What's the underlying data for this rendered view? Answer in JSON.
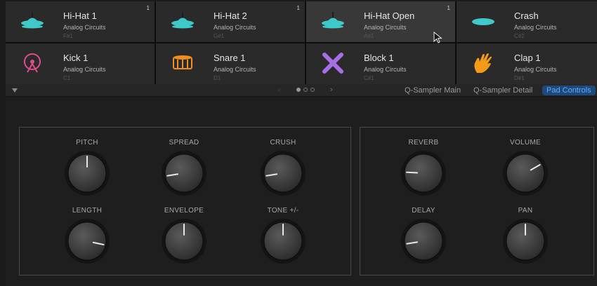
{
  "pads": [
    {
      "name": "Hi-Hat 1",
      "kit": "Analog Circuits",
      "note": "F#1",
      "badge": "1",
      "icon": "hihat-icon",
      "color": "#3fc9c9",
      "selected": false
    },
    {
      "name": "Hi-Hat 2",
      "kit": "Analog Circuits",
      "note": "G#1",
      "badge": "1",
      "icon": "hihat-icon",
      "color": "#3fc9c9",
      "selected": false
    },
    {
      "name": "Hi-Hat Open",
      "kit": "Analog Circuits",
      "note": "A#1",
      "badge": "1",
      "icon": "hihat-icon",
      "color": "#3fc9c9",
      "selected": true
    },
    {
      "name": "Crash",
      "kit": "Analog Circuits",
      "note": "C#2",
      "badge": "",
      "icon": "crash-cymbal-icon",
      "color": "#3fc9c9",
      "selected": false
    },
    {
      "name": "Kick 1",
      "kit": "Analog Circuits",
      "note": "C1",
      "badge": "",
      "icon": "kick-drum-icon",
      "color": "#e14c8c",
      "selected": false
    },
    {
      "name": "Snare 1",
      "kit": "Analog Circuits",
      "note": "D1",
      "badge": "",
      "icon": "snare-drum-icon",
      "color": "#ef8f1e",
      "selected": false
    },
    {
      "name": "Block 1",
      "kit": "Analog Circuits",
      "note": "C#1",
      "badge": "",
      "icon": "block-sticks-icon",
      "color": "#a86ee6",
      "selected": false
    },
    {
      "name": "Clap 1",
      "kit": "Analog Circuits",
      "note": "D#1",
      "badge": "",
      "icon": "clap-hand-icon",
      "color": "#f39a1a",
      "selected": false
    }
  ],
  "toolbar": {
    "prev": "‹",
    "next": "›",
    "page_dots": 3,
    "current_page": 1,
    "tabs": [
      {
        "label": "Q-Sampler Main",
        "active": false
      },
      {
        "label": "Q-Sampler Detail",
        "active": false
      },
      {
        "label": "Pad Controls",
        "active": true
      }
    ]
  },
  "knobs_left": [
    {
      "label": "PITCH",
      "value": 0.5
    },
    {
      "label": "SPREAD",
      "value": 0.17
    },
    {
      "label": "CRUSH",
      "value": 0.17
    },
    {
      "label": "LENGTH",
      "value": 0.84
    },
    {
      "label": "ENVELOPE",
      "value": 0.5
    },
    {
      "label": "TONE +/-",
      "value": 0.5
    }
  ],
  "knobs_right": [
    {
      "label": "REVERB",
      "value": 0.21
    },
    {
      "label": "VOLUME",
      "value": 0.7
    },
    {
      "label": "DELAY",
      "value": 0.17
    },
    {
      "label": "PAN",
      "value": 0.5
    }
  ],
  "colors": {
    "accent": "#1d4a7e",
    "accent_text": "#6aa8ef",
    "knob_indicator": "#e8e8e8"
  }
}
